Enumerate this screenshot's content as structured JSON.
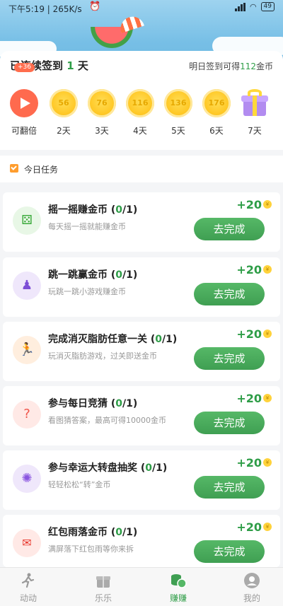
{
  "status_bar": {
    "time": "下午5:19 | 265K/s",
    "alarm_icon": "alarm-icon",
    "battery": "49"
  },
  "signin": {
    "title_prefix": "已连续签到",
    "days": "1",
    "title_suffix": "天",
    "badge": "+36",
    "hint_prefix": "明日签到可得",
    "hint_amount": "112",
    "hint_suffix": "金币",
    "items": [
      {
        "label": "可翻倍",
        "icon": "play-icon"
      },
      {
        "label": "2天",
        "value": "56"
      },
      {
        "label": "3天",
        "value": "76"
      },
      {
        "label": "4天",
        "value": "116"
      },
      {
        "label": "5天",
        "value": "136"
      },
      {
        "label": "6天",
        "value": "176"
      },
      {
        "label": "7天",
        "icon": "gift-icon"
      }
    ]
  },
  "section": {
    "title": "今日任务"
  },
  "tasks": [
    {
      "name": "摇一摇赚金币",
      "progress_open": " (",
      "progress": "0",
      "progress_close": "/1)",
      "desc": "每天摇一摇就能赚金币",
      "reward": "+20",
      "button": "去完成",
      "icon": "dice-icon",
      "icon_bg": "#e8f7e6",
      "icon_color": "#3aaa3a"
    },
    {
      "name": "跳一跳赢金币",
      "progress_open": " (",
      "progress": "0",
      "progress_close": "/1)",
      "desc": "玩跳一跳小游戏赚金币",
      "reward": "+20",
      "button": "去完成",
      "icon": "jump-icon",
      "icon_bg": "#efe7fb",
      "icon_color": "#7d4ed6"
    },
    {
      "name": "完成消灭脂肪任意一关",
      "progress_open": " (",
      "progress": "0",
      "progress_close": "/1)",
      "desc": "玩消灭脂肪游戏，过关即送金币",
      "reward": "+20",
      "button": "去完成",
      "icon": "runner-icon",
      "icon_bg": "#ffeede",
      "icon_color": "#f07a28"
    },
    {
      "name": "参与每日竞猜",
      "progress_open": " (",
      "progress": "0",
      "progress_close": "/1)",
      "desc": "看图猜答案，最高可得10000金币",
      "reward": "+20",
      "button": "去完成",
      "icon": "question-icon",
      "icon_bg": "#ffe9e6",
      "icon_color": "#f0554a"
    },
    {
      "name": "参与幸运大转盘抽奖",
      "progress_open": " (",
      "progress": "0",
      "progress_close": "/1)",
      "desc": "轻轻松松“转”金币",
      "reward": "+20",
      "button": "去完成",
      "icon": "wheel-icon",
      "icon_bg": "#efe7fb",
      "icon_color": "#8a55e0"
    },
    {
      "name": "红包雨落金币",
      "progress_open": " (",
      "progress": "0",
      "progress_close": "/1)",
      "desc": "满屏落下红包雨等你来拆",
      "reward": "+20",
      "button": "去完成",
      "icon": "red-envelope-icon",
      "icon_bg": "#ffe9e6",
      "icon_color": "#e8362c"
    }
  ],
  "nav": [
    {
      "label": "动动",
      "icon": "run-icon"
    },
    {
      "label": "乐乐",
      "icon": "gift-icon"
    },
    {
      "label": "赚赚",
      "icon": "coins-icon",
      "active": true
    },
    {
      "label": "我的",
      "icon": "profile-icon"
    }
  ]
}
